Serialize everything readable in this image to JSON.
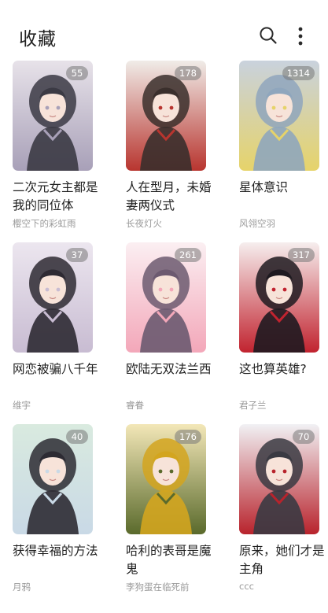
{
  "header": {
    "title": "收藏"
  },
  "items": [
    {
      "title": "二次元女主都是我的同位体",
      "author": "樱空下的彩虹雨",
      "count": "55",
      "palette": [
        "#e7e2e9",
        "#3b3a44",
        "#a8a0b8"
      ]
    },
    {
      "title": "人在型月，未婚妻两仪式",
      "author": "长夜灯火",
      "count": "178",
      "palette": [
        "#f0ece8",
        "#3a2f2c",
        "#b8352f"
      ]
    },
    {
      "title": "星体意识",
      "author": "风翎空羽",
      "count": "1314",
      "palette": [
        "#c9d2dd",
        "#8fa6bd",
        "#e6d36a"
      ]
    },
    {
      "title": "网恋被骗八千年",
      "author": "维宇",
      "count": "37",
      "palette": [
        "#ece6ef",
        "#2e2a33",
        "#c8bcd2"
      ]
    },
    {
      "title": "欧陆无双法兰西",
      "author": "睿眷",
      "count": "261",
      "palette": [
        "#fbeff2",
        "#6c5a70",
        "#f3a7b9"
      ]
    },
    {
      "title": "这也算英雄?",
      "author": "君子兰",
      "count": "317",
      "palette": [
        "#f6eeee",
        "#1e1a20",
        "#c1232f"
      ]
    },
    {
      "title": "获得幸福的方法",
      "author": "月鸦",
      "count": "40",
      "palette": [
        "#d9eadf",
        "#2d2b33",
        "#c9d9e6"
      ]
    },
    {
      "title": "哈利的表哥是魔鬼",
      "author": "李狗蛋在临死前",
      "count": "176",
      "palette": [
        "#f3e7b8",
        "#d3a51f",
        "#5a6a2c"
      ]
    },
    {
      "title": "原来，她们才是主角",
      "author": "ccc",
      "count": "70",
      "palette": [
        "#f1f1f4",
        "#3a3a42",
        "#b8232c"
      ]
    }
  ]
}
